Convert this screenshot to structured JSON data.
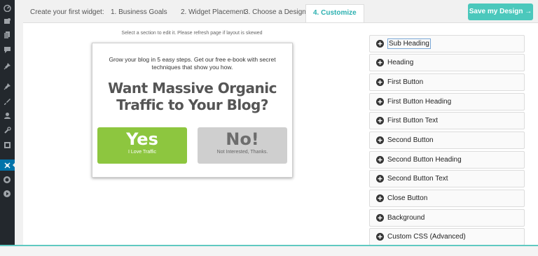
{
  "sidebar": {
    "icons": [
      "dashboard-icon",
      "media-icon",
      "pages-icon",
      "comments-icon",
      "pin-icon",
      "pin-icon",
      "brush-icon",
      "user-icon",
      "tools-icon",
      "settings-icon",
      "plugin-icon",
      "circle-icon",
      "play-icon"
    ],
    "accent": "#0073aa"
  },
  "tabs": {
    "intro": "Create your first widget:",
    "items": [
      "1. Business Goals",
      "2. Widget Placement",
      "3. Choose a Design",
      "4. Customize"
    ],
    "active_index": 3,
    "save_label": "Save my Design →"
  },
  "editor": {
    "hint": "Select a section to edit it. Please refresh page if layout is skewed"
  },
  "widget": {
    "subheading": "Grow your blog in 5 easy steps. Get our free e-book with secret techniques that show you how.",
    "heading": "Want Massive Organic Traffic to Your Blog?",
    "first_button": {
      "title": "Yes",
      "text": "I Love Traffic",
      "color": "#8dc63f"
    },
    "second_button": {
      "title": "No!",
      "text": "Not Interested, Thanks.",
      "color": "#cfcfcf"
    }
  },
  "sections": {
    "selected_index": 0,
    "items": [
      "Sub Heading",
      "Heading",
      "First Button",
      "First Button Heading",
      "First Button Text",
      "Second Button",
      "Second Button Heading",
      "Second Button Text",
      "Close Button",
      "Background",
      "Custom CSS (Advanced)"
    ]
  },
  "colors": {
    "teal": "#4bc8bc",
    "active_tab": "#2bb0b0"
  }
}
